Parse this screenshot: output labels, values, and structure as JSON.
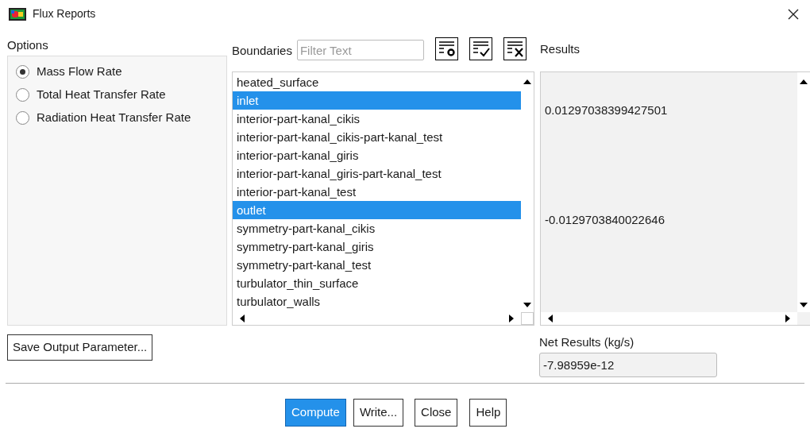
{
  "window": {
    "title": "Flux Reports"
  },
  "options": {
    "label": "Options",
    "items": [
      {
        "label": "Mass Flow Rate",
        "selected": true
      },
      {
        "label": "Total Heat Transfer Rate",
        "selected": false
      },
      {
        "label": "Radiation Heat Transfer Rate",
        "selected": false
      }
    ]
  },
  "boundaries": {
    "label": "Boundaries",
    "filter_placeholder": "Filter Text",
    "items": [
      {
        "label": "heated_surface",
        "selected": false
      },
      {
        "label": "inlet",
        "selected": true
      },
      {
        "label": "interior-part-kanal_cikis",
        "selected": false
      },
      {
        "label": "interior-part-kanal_cikis-part-kanal_test",
        "selected": false
      },
      {
        "label": "interior-part-kanal_giris",
        "selected": false
      },
      {
        "label": "interior-part-kanal_giris-part-kanal_test",
        "selected": false
      },
      {
        "label": "interior-part-kanal_test",
        "selected": false
      },
      {
        "label": "outlet",
        "selected": true
      },
      {
        "label": "symmetry-part-kanal_cikis",
        "selected": false
      },
      {
        "label": "symmetry-part-kanal_giris",
        "selected": false
      },
      {
        "label": "symmetry-part-kanal_test",
        "selected": false
      },
      {
        "label": "turbulator_thin_surface",
        "selected": false
      },
      {
        "label": "turbulator_walls",
        "selected": false
      }
    ]
  },
  "results": {
    "label": "Results",
    "values": [
      "0.01297038399427501",
      "-0.0129703840022646"
    ]
  },
  "save_button": "Save Output Parameter...",
  "net_results": {
    "label": "Net Results (kg/s)",
    "value": "-7.98959e-12"
  },
  "buttons": [
    {
      "label": "Compute",
      "primary": true
    },
    {
      "label": "Write...",
      "primary": false
    },
    {
      "label": "Close",
      "primary": false
    },
    {
      "label": "Help",
      "primary": false
    }
  ]
}
